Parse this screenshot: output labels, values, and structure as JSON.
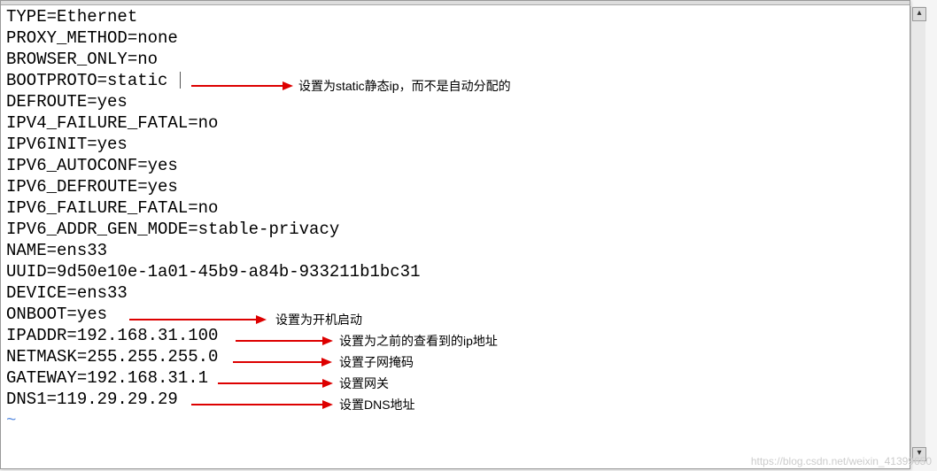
{
  "config_lines": [
    "TYPE=Ethernet",
    "PROXY_METHOD=none",
    "BROWSER_ONLY=no",
    "BOOTPROTO=static",
    "DEFROUTE=yes",
    "IPV4_FAILURE_FATAL=no",
    "IPV6INIT=yes",
    "IPV6_AUTOCONF=yes",
    "IPV6_DEFROUTE=yes",
    "IPV6_FAILURE_FATAL=no",
    "IPV6_ADDR_GEN_MODE=stable-privacy",
    "NAME=ens33",
    "UUID=9d50e10e-1a01-45b9-a84b-933211b1bc31",
    "DEVICE=ens33",
    "ONBOOT=yes",
    "IPADDR=192.168.31.100",
    "NETMASK=255.255.255.0",
    "GATEWAY=192.168.31.1",
    "DNS1=119.29.29.29"
  ],
  "annotations": {
    "bootproto": "设置为static静态ip，而不是自动分配的",
    "onboot": "设置为开机启动",
    "ipaddr": "设置为之前的查看到的ip地址",
    "netmask": "设置子网掩码",
    "gateway": "设置网关",
    "dns": "设置DNS地址"
  },
  "watermark": "https://blog.csdn.net/weixin_41399650"
}
